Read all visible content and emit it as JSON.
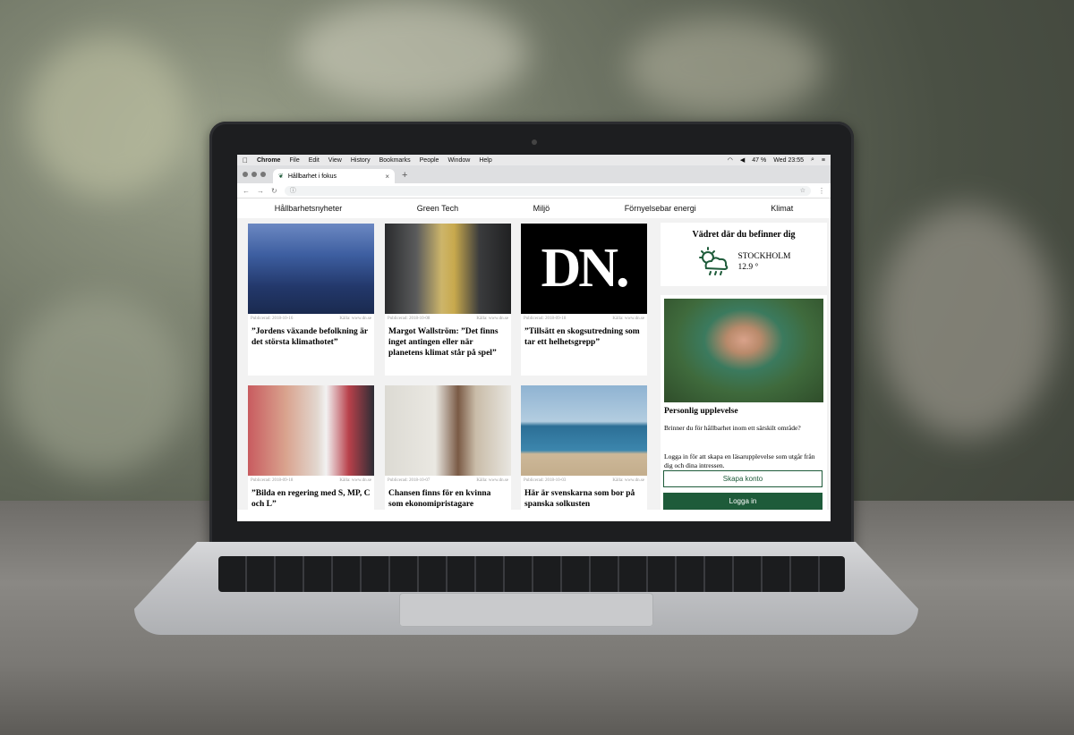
{
  "menubar": {
    "app": "Chrome",
    "items": [
      "File",
      "Edit",
      "View",
      "History",
      "Bookmarks",
      "People",
      "Window",
      "Help"
    ],
    "battery": "47 %",
    "clock": "Wed 23:55"
  },
  "tab": {
    "title": "Hållbarhet i fokus"
  },
  "site": {
    "nav": [
      "Hållbarhetsnyheter",
      "Green Tech",
      "Miljö",
      "Förnyelsebar energi",
      "Klimat"
    ]
  },
  "articles": [
    {
      "published": "Publicerad: 2018-10-16",
      "source": "Källa: www.dn.se",
      "title": "”Jordens växande befolkning är det största klimathotet”"
    },
    {
      "published": "Publicerad: 2018-10-08",
      "source": "Källa: www.dn.se",
      "title": "Margot Wallström: ”Det finns inget antingen eller när planetens klimat står på spel”"
    },
    {
      "published": "Publicerad: 2018-09-18",
      "source": "Källa: www.dn.se",
      "title": "”Tillsätt en skogsutredning som tar ett helhetsgrepp”"
    },
    {
      "published": "Publicerad: 2018-09-18",
      "source": "Källa: www.dn.se",
      "title": "”Bilda en regering med S, MP, C och L”"
    },
    {
      "published": "Publicerad: 2018-10-07",
      "source": "Källa: www.dn.se",
      "title": "Chansen finns för en kvinna som ekonomipristagare"
    },
    {
      "published": "Publicerad: 2018-10-03",
      "source": "Källa: www.dn.se",
      "title": "Här är svenskarna som bor på spanska solkusten"
    }
  ],
  "logo": {
    "text": "DN."
  },
  "weather": {
    "heading": "Vädret där du befinner dig",
    "city": "STOCKHOLM",
    "temp": "12.9 °"
  },
  "personal": {
    "title": "Personlig upplevelse",
    "text1": "Brinner du för hållbarhet inom ett särskilt område?",
    "text2": "Logga in för att skapa en läsarupplevelse som utgår från dig och dina intressen.",
    "create_label": "Skapa konto",
    "login_label": "Logga in"
  },
  "colors": {
    "accent": "#1e5b3a"
  }
}
